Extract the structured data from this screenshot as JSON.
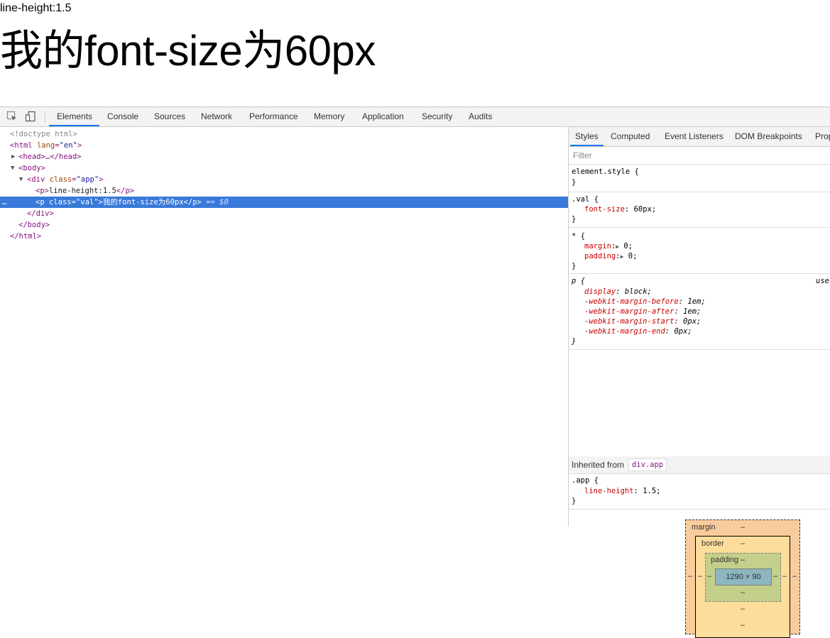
{
  "page": {
    "small_text": "line-height:1.5",
    "big_text": "我的font-size为60px"
  },
  "devtools": {
    "toolbar": {
      "tabs": [
        "Elements",
        "Console",
        "Sources",
        "Network",
        "Performance",
        "Memory",
        "Application",
        "Security",
        "Audits"
      ],
      "active_tab": "Elements"
    },
    "elements": {
      "doctype": "<!doctype html>",
      "html_open": "html",
      "html_lang_attr": "lang",
      "html_lang_val": "\"en\"",
      "head": "<head>…</head>",
      "body_open": "<body>",
      "div_tag": "div",
      "div_attr": "class",
      "div_val": "\"app\"",
      "p1_open": "<p>",
      "p1_text": "line-height:1.5",
      "p1_close": "</p>",
      "p2_tag": "p",
      "p2_attr": "class",
      "p2_val": "\"val\"",
      "p2_text": "我的font-size为60px",
      "p2_close": "</p>",
      "selected_marker": "== $0",
      "ellipsis": "…",
      "div_close": "</div>",
      "body_close": "</body>",
      "html_close": "</html>"
    },
    "styles": {
      "tabs": [
        "Styles",
        "Computed",
        "Event Listeners",
        "DOM Breakpoints",
        "Prop"
      ],
      "active_tab": "Styles",
      "filter_placeholder": "Filter",
      "element_style": "element.style {",
      "close_brace": "}",
      "rule_val_selector": ".val {",
      "rule_val_prop": "font-size",
      "rule_val_value": "60px;",
      "rule_star_selector": "* {",
      "rule_star_margin_prop": "margin",
      "rule_star_margin_val": "0;",
      "rule_star_padding_prop": "padding",
      "rule_star_padding_val": "0;",
      "ua_selector": "p {",
      "ua_source": "use",
      "ua_props": [
        {
          "prop": "display",
          "val": "block;"
        },
        {
          "prop": "-webkit-margin-before",
          "val": "1em;"
        },
        {
          "prop": "-webkit-margin-after",
          "val": "1em;"
        },
        {
          "prop": "-webkit-margin-start",
          "val": "0px;"
        },
        {
          "prop": "-webkit-margin-end",
          "val": "0px;"
        }
      ],
      "inherited_label": "Inherited from",
      "inherited_chip": "div.app",
      "app_selector": ".app {",
      "app_prop": "line-height",
      "app_val": "1.5;"
    },
    "box_model": {
      "margin_label": "margin",
      "border_label": "border",
      "padding_label": "padding",
      "content_size": "1290 × 90",
      "dash": "–"
    }
  }
}
